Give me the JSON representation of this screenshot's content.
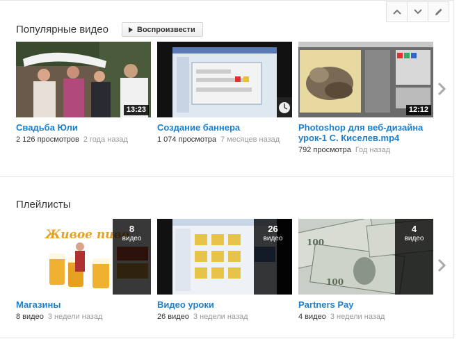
{
  "colors": {
    "link": "#1b7fcc",
    "meta_gray": "#999999",
    "border": "#e5e5e5"
  },
  "controls": [
    {
      "name": "move-up-button",
      "icon": "chevron-up-icon"
    },
    {
      "name": "move-down-button",
      "icon": "chevron-down-icon"
    },
    {
      "name": "edit-button",
      "icon": "pencil-icon"
    }
  ],
  "popular": {
    "title": "Популярные видео",
    "play_all_label": "Воспроизвести",
    "videos": [
      {
        "title": "Свадьба Юли",
        "views": "2 126 просмотров",
        "age": "2 года назад",
        "duration": "13:23",
        "thumb": "wedding"
      },
      {
        "title": "Создание баннера",
        "views": "1 074 просмотра",
        "age": "7 месяцев назад",
        "duration": "",
        "thumb": "screen"
      },
      {
        "title": "Photoshop для веб-дизайна урок-1 С. Киселев.mp4",
        "views": "792 просмотра",
        "age": "Год назад",
        "duration": "12:12",
        "thumb": "photoshop"
      }
    ]
  },
  "playlists": {
    "title": "Плейлисты",
    "items": [
      {
        "title": "Магазины",
        "count": "8",
        "count_label": "видео",
        "videos": "8 видео",
        "age": "3 недели назад",
        "thumb": "beer"
      },
      {
        "title": "Видео уроки",
        "count": "26",
        "count_label": "видео",
        "videos": "26 видео",
        "age": "3 недели назад",
        "thumb": "folders"
      },
      {
        "title": "Partners Pay",
        "count": "4",
        "count_label": "видео",
        "videos": "4 видео",
        "age": "3 недели назад",
        "thumb": "dollars"
      }
    ]
  }
}
